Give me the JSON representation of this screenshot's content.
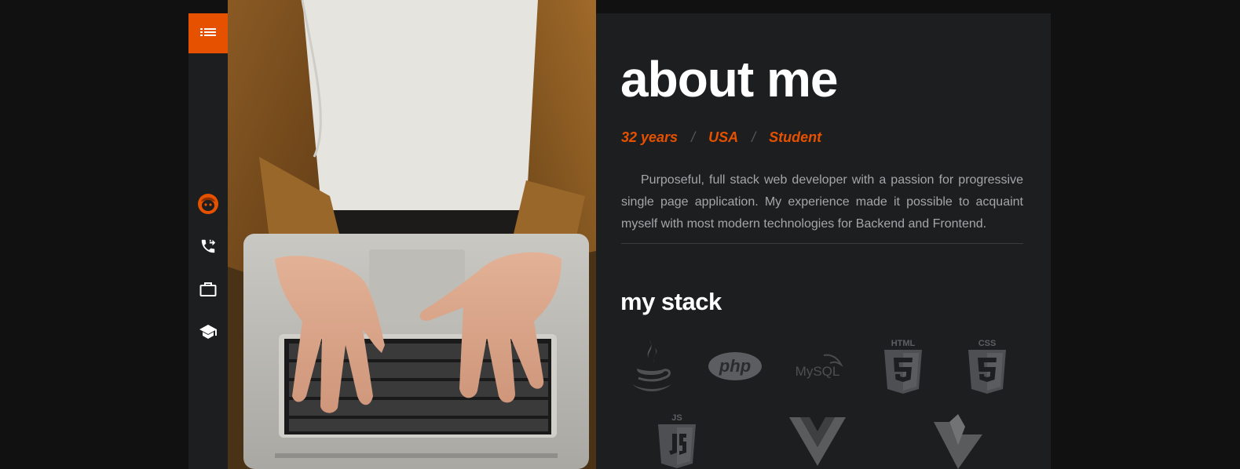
{
  "sidebar": {
    "menu_icon": "list-icon",
    "items": [
      {
        "icon": "avatar-face-icon",
        "active": true
      },
      {
        "icon": "phone-transfer-icon",
        "active": false
      },
      {
        "icon": "briefcase-icon",
        "active": false
      },
      {
        "icon": "graduation-cap-icon",
        "active": false
      }
    ]
  },
  "colors": {
    "accent": "#e65100",
    "background": "#111111",
    "panel": "#1d1e20",
    "text_muted": "#a4a6a8"
  },
  "about": {
    "title": "about me",
    "meta": {
      "age": "32 years",
      "country": "USA",
      "role": "Student",
      "separator": "/"
    },
    "bio": "Purposeful, full stack web developer with a passion for progressive single page application. My experience made it possible to acquaint myself with most modern technologies for Backend and Frontend."
  },
  "stack": {
    "title": "my stack",
    "technologies": [
      {
        "icon": "java-icon",
        "label": ""
      },
      {
        "icon": "php-icon",
        "label": "php"
      },
      {
        "icon": "mysql-icon",
        "label": "MySQL"
      },
      {
        "icon": "html5-icon",
        "label": "HTML"
      },
      {
        "icon": "css3-icon",
        "label": "CSS"
      },
      {
        "icon": "javascript-icon",
        "label": "JS"
      },
      {
        "icon": "vue-icon",
        "label": ""
      },
      {
        "icon": "vuetify-icon",
        "label": ""
      }
    ]
  }
}
